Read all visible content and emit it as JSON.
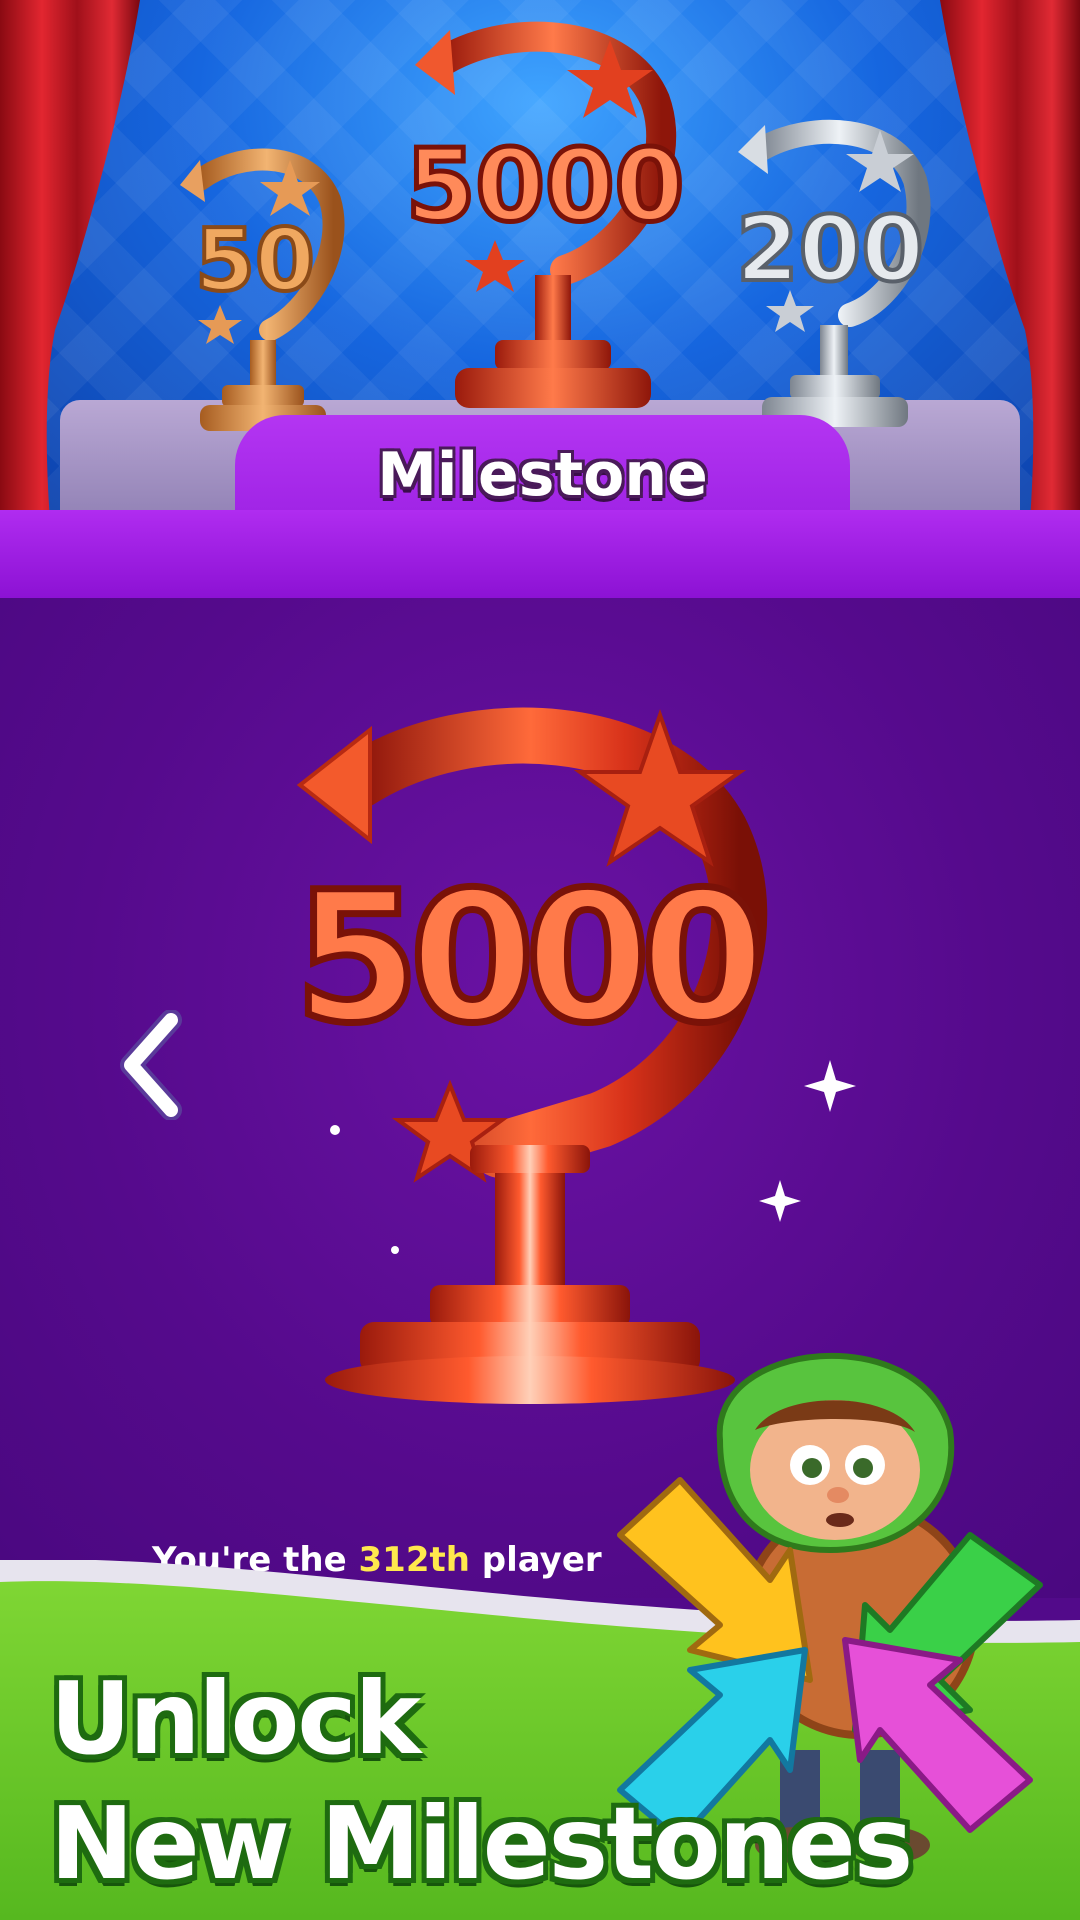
{
  "header": {
    "title": "Milestone"
  },
  "trophies": {
    "left": {
      "value": "50",
      "tier": "bronze"
    },
    "center": {
      "value": "5000",
      "tier": "red"
    },
    "right": {
      "value": "200",
      "tier": "silver"
    },
    "featured": {
      "value": "5000",
      "tier": "red"
    }
  },
  "info": {
    "prefix": "You're the",
    "rank": "312th",
    "suffix": "player"
  },
  "promo": {
    "line1": "Unlock",
    "line2": "New Milestones"
  },
  "colors": {
    "stage_blue": "#1666df",
    "band_purple": "#a828ec",
    "main_purple": "#550a8c",
    "trophy_red": "#e2401f",
    "promo_green": "#6cc72a",
    "rank_yellow": "#ffe94d"
  },
  "icons": {
    "prev": "chevron-left-icon"
  }
}
